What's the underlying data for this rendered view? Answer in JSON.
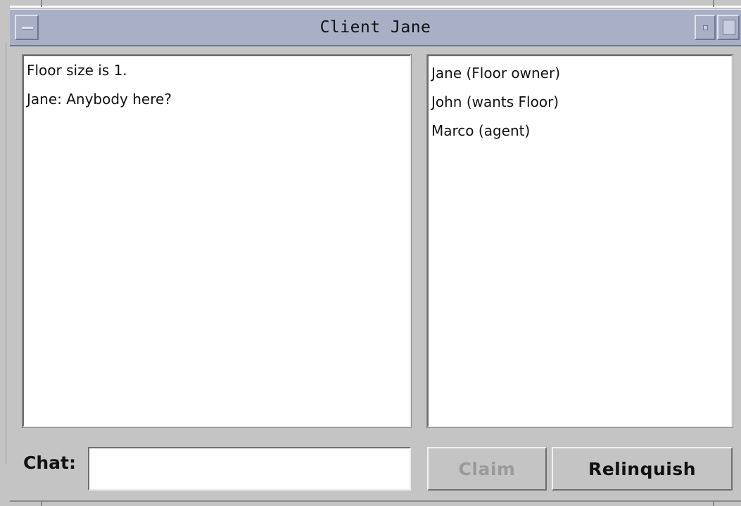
{
  "window": {
    "title": "Client Jane",
    "menu_icon": "window-menu-icon",
    "minimize_icon": "minimize-icon",
    "maximize_icon": "maximize-icon",
    "titlebar_color": "#a9b0c6"
  },
  "chat_log": {
    "lines": [
      "Floor size is 1.",
      "Jane: Anybody here?"
    ]
  },
  "user_list": {
    "items": [
      "Jane (Floor owner)",
      "John (wants Floor)",
      "Marco (agent)"
    ]
  },
  "chat_input": {
    "label": "Chat:",
    "value": "",
    "placeholder": ""
  },
  "buttons": {
    "claim": {
      "label": "Claim",
      "enabled": false
    },
    "relinquish": {
      "label": "Relinquish",
      "enabled": true
    }
  }
}
